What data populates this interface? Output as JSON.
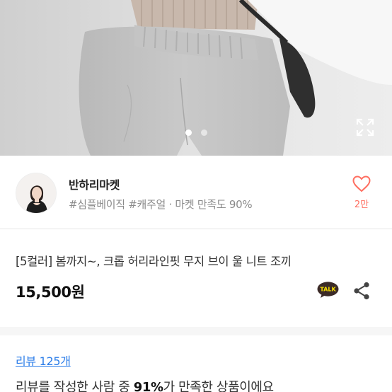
{
  "hero": {
    "slide_count": 2,
    "active_slide": 1,
    "expand_icon": "expand-arrows-icon"
  },
  "seller": {
    "name": "반하리마켓",
    "tags": "#심플베이직 #캐주얼 · 마켓 만족도 90%",
    "like_icon": "heart-outline-icon",
    "like_count": "2만"
  },
  "product": {
    "title": "[5컬러] 봄까지~, 크롭 허리라인핏 무지 브이 울 니트 조끼",
    "price": "15,500원",
    "talk_label": "TALK",
    "talk_color": "#3b2a27",
    "share_icon": "share-icon"
  },
  "review": {
    "link_label": "리뷰 125개",
    "summary_prefix": "리뷰를 작성한 사람 중 ",
    "summary_percent": "91%",
    "summary_suffix": "가 만족한 상품이에요"
  },
  "colors": {
    "accent_heart": "#ff6f61",
    "link": "#2b7de9"
  }
}
